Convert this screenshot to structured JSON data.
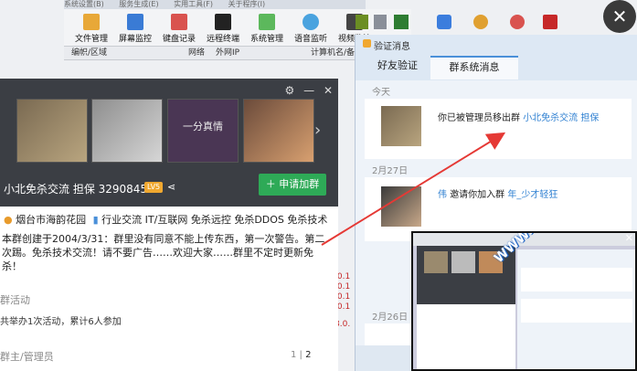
{
  "app": {
    "menu": [
      "系统设置(B)",
      "服务生成(E)",
      "实用工具(F)",
      "关于程序(I)"
    ],
    "toolbar": [
      {
        "label": "文件管理",
        "icon": "folder-icon",
        "color": "#e8a838"
      },
      {
        "label": "屏幕监控",
        "icon": "monitor-icon",
        "color": "#3a7bd5"
      },
      {
        "label": "键盘记录",
        "icon": "keyboard-icon",
        "color": "#d9534f"
      },
      {
        "label": "远程终端",
        "icon": "terminal-icon",
        "color": "#222222"
      },
      {
        "label": "系统管理",
        "icon": "system-icon",
        "color": "#5cb85c"
      },
      {
        "label": "语音监听",
        "icon": "speaker-icon",
        "color": "#4aa3df"
      },
      {
        "label": "视频监控",
        "icon": "camera-icon",
        "color": "#444444"
      }
    ],
    "columns": [
      "编帜/区域",
      "网络",
      "外网IP",
      "计算机名/备"
    ],
    "red_log": [
      ".0.1",
      ".0.1",
      ".0.1",
      ".0.1",
      "8.0."
    ]
  },
  "group": {
    "title": "小北免杀交流 担保 3290845",
    "level": "LV5",
    "join": "申请加群",
    "location": "烟台市海韵花园",
    "tags": "行业交流  IT/互联网  免杀远控  免杀DDOS  免杀技术",
    "thumb_caption": "一分真情",
    "description": "本群创建于2004/3/31：群里没有同意不能上传东西，第一次警告。第二次踢。免杀技术交流！请不要广告……欢迎大家……群里不定时更新免杀！",
    "activity_label": "群活动",
    "activity_text": "共举办1次活动，累计6人参加",
    "admin_label": "群主/管理员",
    "pager_current": "1",
    "pager_total": "2"
  },
  "popup": {
    "title": "验证消息",
    "tabs": [
      "好友验证",
      "群系统消息"
    ],
    "messages": [
      {
        "date": "今天",
        "prefix": "你已被管理员移出群",
        "link": "小北免杀交流 担保",
        "suffix": ""
      },
      {
        "date": "2月27日",
        "name": "伟",
        "prefix": "邀请你加入群",
        "link": "年_少才轻狂",
        "suffix": ""
      },
      {
        "date": "2月26日"
      }
    ]
  },
  "mini": {
    "watermark": "WWW.HONGLANHACKER.COM 红蓝安全网"
  },
  "colors": {
    "accent_blue": "#4a90d9",
    "link_blue": "#2d7fd1",
    "join_green": "#2eaa57",
    "arrow_red": "#e53935"
  }
}
